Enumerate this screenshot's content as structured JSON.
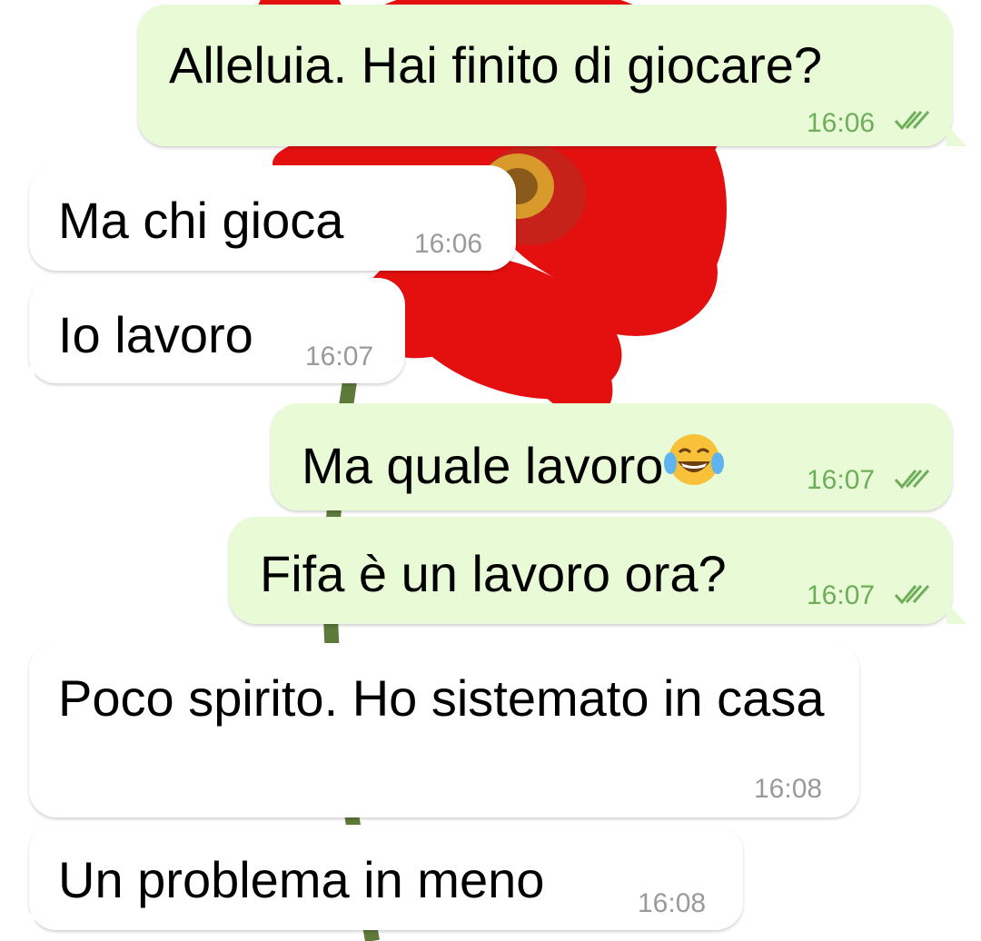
{
  "colors": {
    "outgoing_bubble": "#e9fbd6",
    "incoming_bubble": "#ffffff",
    "outgoing_time": "#6eae5a",
    "incoming_time": "#9a9a9a",
    "read_ticks": "#6eae5a",
    "flower_petals": "#e3100f"
  },
  "wallpaper": {
    "description_icon": "red-gerbera-flower-icon"
  },
  "messages": [
    {
      "direction": "outgoing",
      "text": "Alleluia. Hai finito di giocare?",
      "time": "16:06",
      "status_icon": "double-check-icon"
    },
    {
      "direction": "incoming",
      "text": "Ma chi gioca",
      "time": "16:06"
    },
    {
      "direction": "incoming",
      "text": "Io lavoro",
      "time": "16:07"
    },
    {
      "direction": "outgoing",
      "text": "Ma quale lavoro",
      "emoji": "face-with-tears-of-joy-icon",
      "time": "16:07",
      "status_icon": "double-check-icon"
    },
    {
      "direction": "outgoing",
      "text": "Fifa è un lavoro ora?",
      "time": "16:07",
      "status_icon": "double-check-icon"
    },
    {
      "direction": "incoming",
      "text": "Poco spirito. Ho sistemato in casa",
      "time": "16:08"
    },
    {
      "direction": "incoming",
      "text": "Un problema in meno",
      "time": "16:08"
    }
  ]
}
